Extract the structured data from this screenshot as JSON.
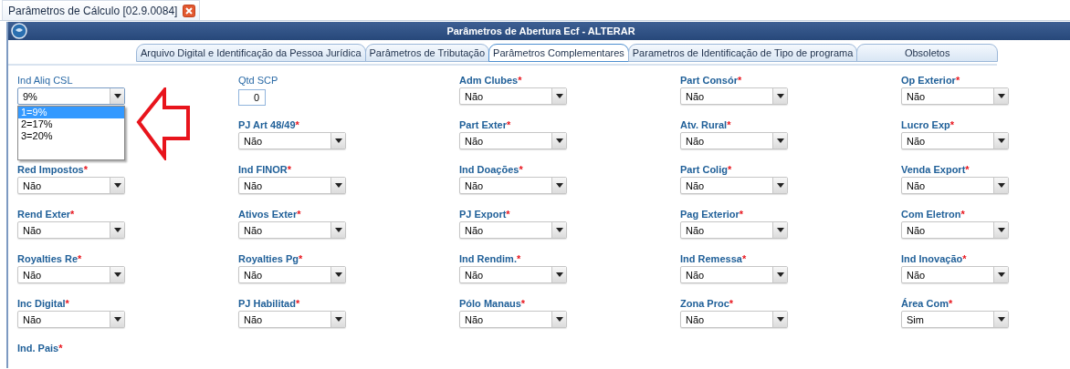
{
  "doc_tab": {
    "title": "Parâmetros de Cálculo [02.9.0084]"
  },
  "window": {
    "title": "Parâmetros de Abertura Ecf - ALTERAR"
  },
  "tabs": [
    {
      "label": "Arquivo Digital e Identificação da Pessoa Jurídica",
      "selected": false
    },
    {
      "label": "Parâmetros de Tributação",
      "selected": false
    },
    {
      "label": "Parâmetros Complementares",
      "selected": true
    },
    {
      "label": "Parametros de Identificação de Tipo de programa",
      "selected": false
    },
    {
      "label": "Obsoletos",
      "selected": false
    }
  ],
  "columns": [
    {
      "fields": [
        {
          "kind": "select",
          "label": "Ind Aliq CSL",
          "value": "9%",
          "expanded": true,
          "options": [
            {
              "label": "1=9%",
              "selected": true
            },
            {
              "label": "2=17%",
              "selected": false
            },
            {
              "label": "3=20%",
              "selected": false
            }
          ]
        },
        {
          "kind": "select",
          "label": "Red Impostos",
          "required": "*",
          "value": "Não"
        },
        {
          "kind": "select",
          "label": "Rend Exter",
          "required": "*",
          "value": "Não"
        },
        {
          "kind": "select",
          "label": "Royalties Re",
          "required": "*",
          "value": "Não"
        },
        {
          "kind": "select",
          "label": "Inc Digital",
          "required": "*",
          "value": "Não"
        },
        {
          "kind": "label",
          "label": "Ind. Pais",
          "required": "*"
        }
      ]
    },
    {
      "fields": [
        {
          "kind": "number",
          "label": "Qtd SCP",
          "value": "0"
        },
        {
          "kind": "select",
          "label": "PJ Art 48/49",
          "required": "*",
          "value": "Não"
        },
        {
          "kind": "select",
          "label": "Ind FINOR",
          "required": "*",
          "value": "Não"
        },
        {
          "kind": "select",
          "label": "Ativos Exter",
          "required": "*",
          "value": "Não"
        },
        {
          "kind": "select",
          "label": "Royalties Pg",
          "required": "*",
          "value": "Não"
        },
        {
          "kind": "select",
          "label": "PJ Habilitad",
          "required": "*",
          "value": "Não"
        }
      ]
    },
    {
      "fields": [
        {
          "kind": "select",
          "label": "Adm Clubes",
          "required": "*",
          "value": "Não"
        },
        {
          "kind": "select",
          "label": "Part Exter",
          "required": "*",
          "value": "Não"
        },
        {
          "kind": "select",
          "label": "Ind Doações",
          "required": "*",
          "value": "Não"
        },
        {
          "kind": "select",
          "label": "PJ Export",
          "required": "*",
          "value": "Não"
        },
        {
          "kind": "select",
          "label": "Ind Rendim.",
          "required": "*",
          "value": "Não"
        },
        {
          "kind": "select",
          "label": "Pólo Manaus",
          "required": "*",
          "value": "Não"
        }
      ]
    },
    {
      "fields": [
        {
          "kind": "select",
          "label": "Part Consór",
          "required": "*",
          "value": "Não"
        },
        {
          "kind": "select",
          "label": "Atv. Rural",
          "required": "*",
          "value": "Não"
        },
        {
          "kind": "select",
          "label": "Part Colig",
          "required": "*",
          "value": "Não"
        },
        {
          "kind": "select",
          "label": "Pag Exterior",
          "required": "*",
          "value": "Não"
        },
        {
          "kind": "select",
          "label": "Ind Remessa",
          "required": "*",
          "value": "Não"
        },
        {
          "kind": "select",
          "label": "Zona Proc",
          "required": "*",
          "value": "Não"
        }
      ]
    },
    {
      "fields": [
        {
          "kind": "select",
          "label": "Op Exterior",
          "required": "*",
          "value": "Não"
        },
        {
          "kind": "select",
          "label": "Lucro Exp",
          "required": "*",
          "value": "Não"
        },
        {
          "kind": "select",
          "label": "Venda Export",
          "required": "*",
          "value": "Não"
        },
        {
          "kind": "select",
          "label": "Com Eletron",
          "required": "*",
          "value": "Não"
        },
        {
          "kind": "select",
          "label": "Ind Inovação",
          "required": "*",
          "value": "Não"
        },
        {
          "kind": "select",
          "label": "Área Com",
          "required": "*",
          "value": "Sim"
        }
      ]
    }
  ]
}
